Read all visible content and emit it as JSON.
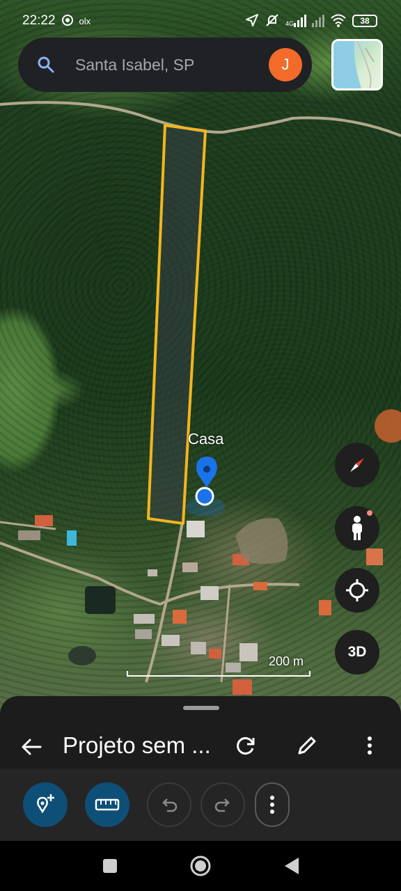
{
  "status_bar": {
    "time": "22:22",
    "app_badge": "olx",
    "network": "4G",
    "battery": "38"
  },
  "search": {
    "placeholder": "Santa Isabel, SP",
    "avatar_initial": "J"
  },
  "map": {
    "place_label": "Casa",
    "scale_label": "200 m",
    "view_mode_label": "3D"
  },
  "project": {
    "title": "Projeto sem ..."
  },
  "icons": {
    "search": "search-icon",
    "compass": "compass-icon",
    "pegman": "pegman-icon",
    "my_location": "my-location-icon",
    "back": "arrow-back-icon",
    "refresh": "refresh-icon",
    "edit": "pencil-icon",
    "more": "more-vert-icon",
    "add_placemark": "add-placemark-icon",
    "measure": "ruler-icon",
    "undo": "undo-icon",
    "redo": "redo-icon"
  },
  "colors": {
    "polygon_outline": "#f2b51f",
    "placemark": "#1a73e8",
    "avatar": "#f26b2a",
    "tool_active": "#0e4f77"
  }
}
